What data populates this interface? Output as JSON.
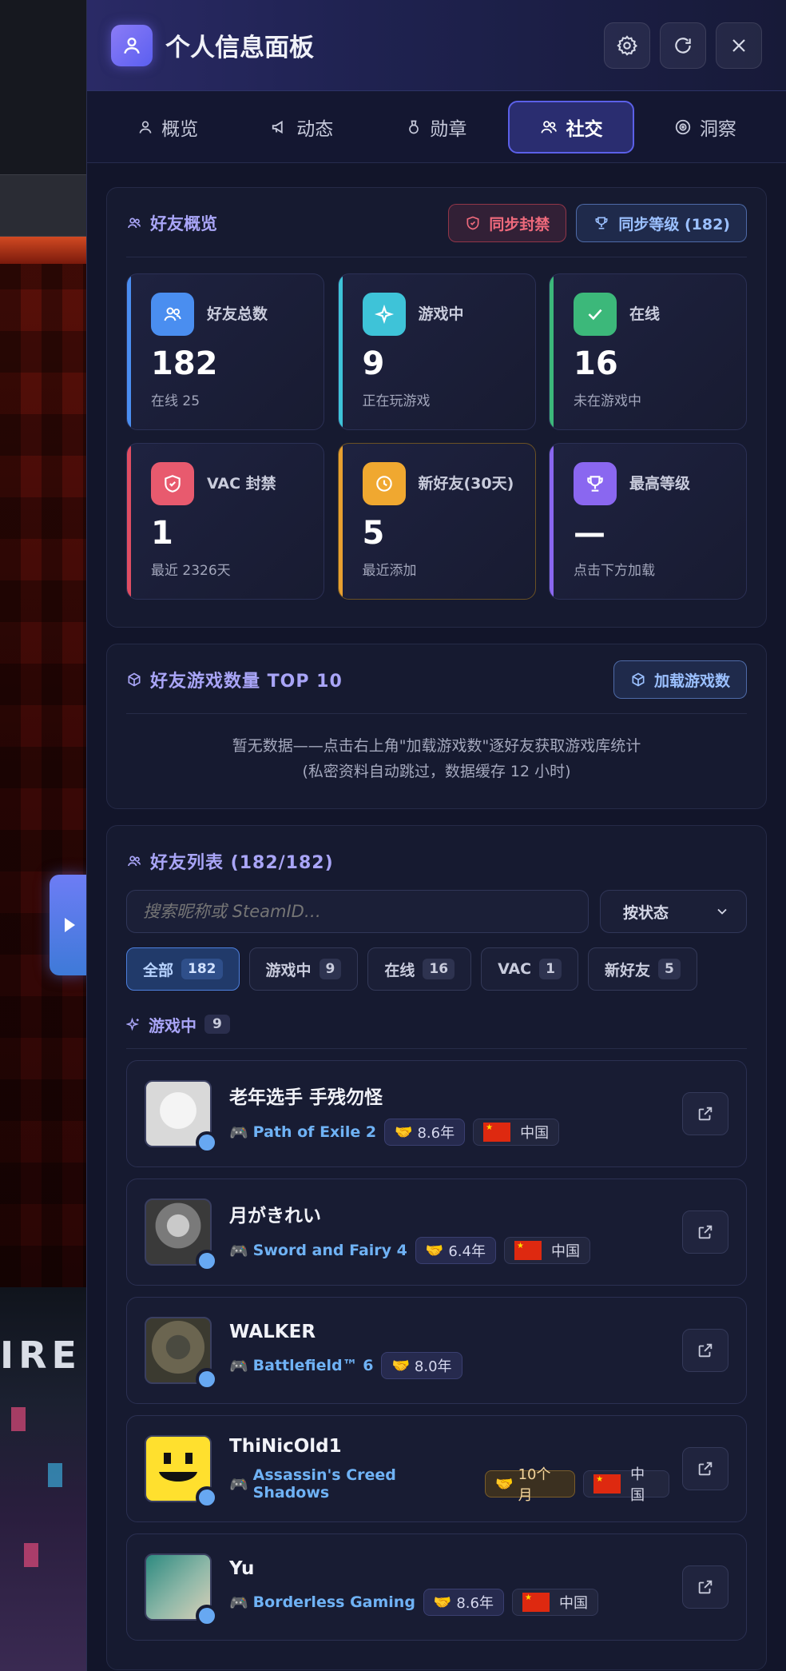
{
  "header": {
    "title": "个人信息面板"
  },
  "tabs": [
    {
      "label": "概览",
      "icon": "user-icon"
    },
    {
      "label": "动态",
      "icon": "megaphone-icon"
    },
    {
      "label": "勋章",
      "icon": "medal-icon"
    },
    {
      "label": "社交",
      "icon": "users-icon",
      "active": true
    },
    {
      "label": "洞察",
      "icon": "target-icon"
    }
  ],
  "overview": {
    "title": "好友概览",
    "sync_ban_label": "同步封禁",
    "sync_level_label": "同步等级 (182)",
    "stats": [
      {
        "label": "好友总数",
        "value": "182",
        "sub": "在线 25",
        "color": "#4a8ef0",
        "icon": "users-icon"
      },
      {
        "label": "游戏中",
        "value": "9",
        "sub": "正在玩游戏",
        "color": "#3ec3d8",
        "icon": "sparkle-icon"
      },
      {
        "label": "在线",
        "value": "16",
        "sub": "未在游戏中",
        "color": "#3cb87a",
        "icon": "check-icon"
      },
      {
        "label": "VAC 封禁",
        "value": "1",
        "sub": "最近 2326天",
        "color": "#e04d62",
        "icon": "shield-icon"
      },
      {
        "label": "新好友(30天)",
        "value": "5",
        "sub": "最近添加",
        "color": "#e8a030",
        "icon": "clock-icon"
      },
      {
        "label": "最高等级",
        "value": "—",
        "sub": "点击下方加载",
        "color": "#8a67f0",
        "icon": "trophy-icon"
      }
    ]
  },
  "top_games": {
    "title": "好友游戏数量 TOP 10",
    "load_label": "加载游戏数",
    "empty_line1": "暂无数据——点击右上角\"加载游戏数\"逐好友获取游戏库统计",
    "empty_line2": "(私密资料自动跳过，数据缓存 12 小时)"
  },
  "friend_list": {
    "title": "好友列表 (182/182)",
    "search_placeholder": "搜索昵称或 SteamID…",
    "sort_label": "按状态",
    "filters": [
      {
        "label": "全部",
        "count": "182",
        "active": true
      },
      {
        "label": "游戏中",
        "count": "9"
      },
      {
        "label": "在线",
        "count": "16"
      },
      {
        "label": "VAC",
        "count": "1"
      },
      {
        "label": "新好友",
        "count": "5"
      }
    ],
    "section_label": "游戏中",
    "section_count": "9",
    "friends": [
      {
        "name": "老年选手 手残勿怪",
        "game": "Path of Exile 2",
        "years": "8.6年",
        "country": "中国"
      },
      {
        "name": "月がきれい",
        "game": "Sword and Fairy 4",
        "years": "6.4年",
        "country": "中国"
      },
      {
        "name": "WALKER",
        "game": "Battlefield™ 6",
        "years": "8.0年",
        "country": ""
      },
      {
        "name": "ThiNicOld1",
        "game": "Assassin's Creed Shadows",
        "years": "10个月",
        "country": "中国"
      },
      {
        "name": "Yu",
        "game": "Borderless Gaming",
        "years": "8.6年",
        "country": "中国"
      }
    ]
  },
  "background": {
    "sign_text": "IRE"
  },
  "colors": {
    "accent": "#5b60e8",
    "link": "#6fb2f5",
    "online_dot": "#67a8f2"
  }
}
